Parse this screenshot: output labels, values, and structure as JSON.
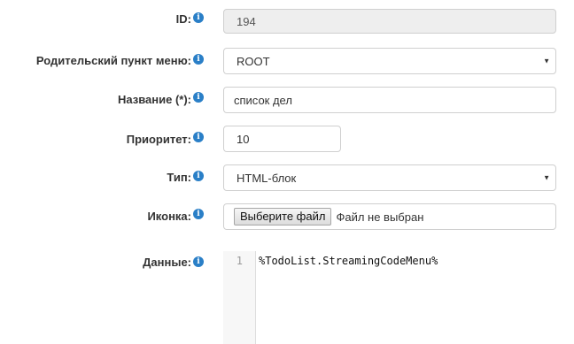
{
  "form": {
    "id": {
      "label": "ID:",
      "value": "194"
    },
    "parent": {
      "label": "Родительский пункт меню:",
      "value": "ROOT"
    },
    "name": {
      "label": "Название (*):",
      "value": "список дел"
    },
    "priority": {
      "label": "Приоритет:",
      "value": "10"
    },
    "type": {
      "label": "Тип:",
      "value": "HTML-блок"
    },
    "icon": {
      "label": "Иконка:",
      "button_label": "Выберите файл",
      "file_status": "Файл не выбран"
    },
    "data": {
      "label": "Данные:",
      "line_number": "1",
      "code": "%TodoList.StreamingCodeMenu%"
    }
  },
  "icons": {
    "info": "info-icon",
    "dropdown": "caret-down-icon"
  },
  "colors": {
    "info_icon": "#2a7fc7",
    "disabled_bg": "#eeeeee"
  }
}
